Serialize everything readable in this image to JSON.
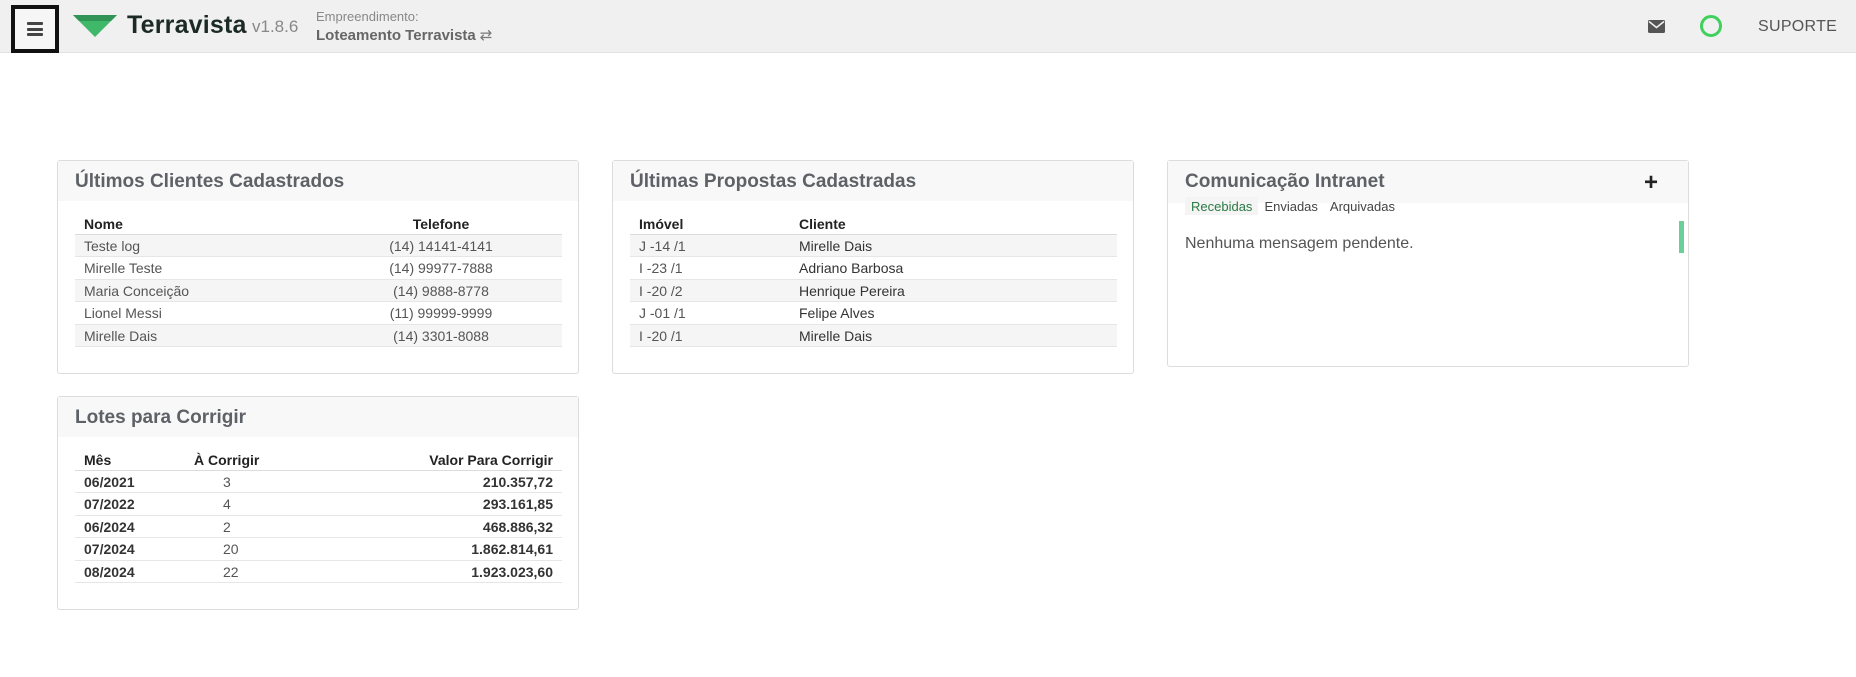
{
  "header": {
    "brand": "Terravista",
    "version": "v1.8.6",
    "empreendimento_label": "Empreendimento:",
    "empreendimento_name": "Loteamento Terravista",
    "swap_glyph": "⇄",
    "support_label": "SUPORTE",
    "accent_color": "#3fb86a",
    "status_color": "#3fd15c"
  },
  "clientes": {
    "title": "Últimos Clientes Cadastrados",
    "columns": [
      "Nome",
      "Telefone"
    ],
    "rows": [
      [
        "Teste log",
        "(14) 14141-4141"
      ],
      [
        "Mirelle Teste",
        "(14) 99977-7888"
      ],
      [
        "Maria Conceição",
        "(14) 9888-8778"
      ],
      [
        "Lionel Messi",
        "(11) 99999-9999"
      ],
      [
        "Mirelle Dais",
        "(14) 3301-8088"
      ]
    ]
  },
  "propostas": {
    "title": "Últimas Propostas Cadastradas",
    "columns": [
      "Imóvel",
      "Cliente"
    ],
    "rows": [
      [
        "J -14 /1",
        "Mirelle Dais"
      ],
      [
        "I -23 /1",
        "Adriano Barbosa"
      ],
      [
        "I -20 /2",
        "Henrique Pereira"
      ],
      [
        "J -01 /1",
        "Felipe Alves"
      ],
      [
        "I -20 /1",
        "Mirelle Dais"
      ]
    ]
  },
  "comunicacao": {
    "title": "Comunicação Intranet",
    "add_glyph": "+",
    "tabs": [
      "Recebidas",
      "Enviadas",
      "Arquivadas"
    ],
    "active_tab": "Recebidas",
    "empty_message": "Nenhuma mensagem pendente."
  },
  "lotes": {
    "title": "Lotes para Corrigir",
    "columns": [
      "Mês",
      "À Corrigir",
      "Valor Para Corrigir"
    ],
    "rows": [
      [
        "06/2021",
        "3",
        "210.357,72"
      ],
      [
        "07/2022",
        "4",
        "293.161,85"
      ],
      [
        "06/2024",
        "2",
        "468.886,32"
      ],
      [
        "07/2024",
        "20",
        "1.862.814,61"
      ],
      [
        "08/2024",
        "22",
        "1.923.023,60"
      ]
    ]
  }
}
